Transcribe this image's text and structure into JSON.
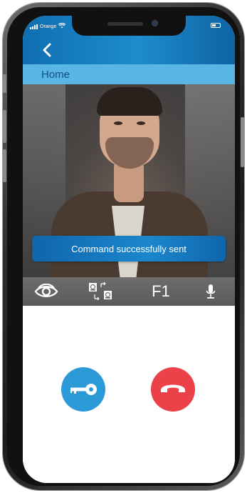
{
  "status_bar": {
    "carrier": "Orange"
  },
  "nav": {
    "back_icon": "chevron-left-icon",
    "title": "Home"
  },
  "video": {
    "toast": "Command successfully sent"
  },
  "toolbar": {
    "view_icon": "eye-icon",
    "switch_icon": "camera-switch-icon",
    "function_label": "F1",
    "mic_icon": "microphone-icon"
  },
  "controls": {
    "unlock_icon": "key-icon",
    "hangup_icon": "phone-hangup-icon"
  },
  "colors": {
    "header": "#1d8ccd",
    "home_bar": "#58b5e4",
    "home_text": "#0f4f8a",
    "toolbar": "#6a6a6a",
    "key_button": "#2b9ad6",
    "hangup_button": "#ec4148"
  }
}
